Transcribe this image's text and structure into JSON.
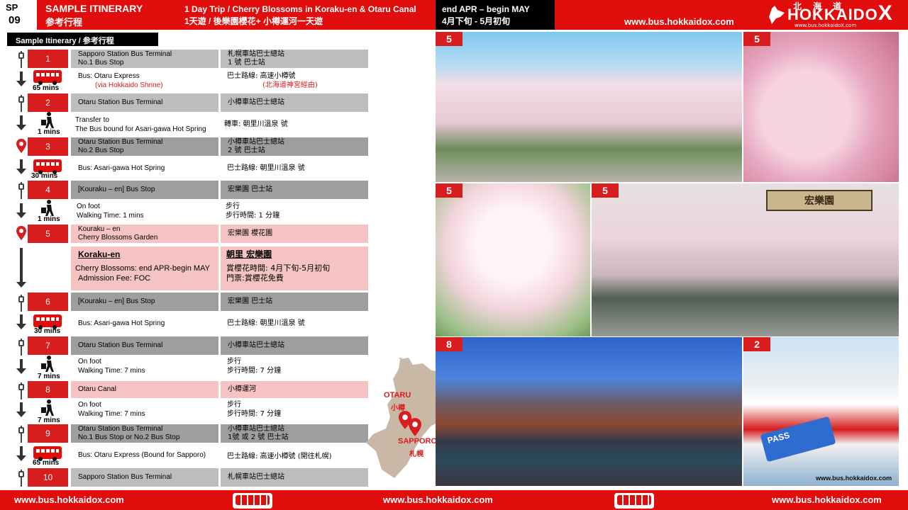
{
  "header": {
    "sp_label": "SP",
    "sp_number": "09",
    "title_en": "SAMPLE ITINERARY",
    "title_zh": "参考行程",
    "trip_en": "1 Day Trip / Cherry Blossoms in Koraku-en & Otaru Canal",
    "trip_zh": "1天遊 / 後樂園櫻花+ 小樽運河一天遊",
    "season_en": "end APR –  begin MAY",
    "season_zh": "4月下旬 - 5月初旬",
    "url": "www.bus.hokkaidox.com",
    "logo_text": "HOKKAIDO",
    "logo_x": "X",
    "logo_kanji": "北海道",
    "logo_sub": "www.bus.hokkaidoX.com"
  },
  "section_label": "Sample Itinerary / 参考行程",
  "stops": [
    {
      "num": "1",
      "en1": "Sapporo Station Bus Terminal",
      "en2": "No.1 Bus Stop",
      "zh1": "札幌車站巴士總站",
      "zh2": "1 號 巴士站"
    },
    {
      "num": "2",
      "en1": "Otaru Station Bus Terminal",
      "en2": "",
      "zh1": "小樽車站巴士總站",
      "zh2": ""
    },
    {
      "num": "3",
      "en1": "Otaru Station Bus Terminal",
      "en2": "No.2 Bus Stop",
      "zh1": "小樽車站巴士總站",
      "zh2": "2 號 巴士站"
    },
    {
      "num": "4",
      "en1": "[Kouraku – en] Bus Stop",
      "en2": "",
      "zh1": "宏樂園 巴士站",
      "zh2": ""
    },
    {
      "num": "5",
      "en1": "Kouraku – en",
      "en2": "Cherry Blossoms Garden",
      "zh1": "宏樂園  櫻花園",
      "zh2": ""
    },
    {
      "num": "6",
      "en1": "[Kouraku – en] Bus Stop",
      "en2": "",
      "zh1": "宏樂園 巴士站",
      "zh2": ""
    },
    {
      "num": "7",
      "en1": "Otaru Station Bus Terminal",
      "en2": "",
      "zh1": "小樽車站巴士總站",
      "zh2": ""
    },
    {
      "num": "8",
      "en1": "Otaru Canal",
      "en2": "",
      "zh1": "小樽運河",
      "zh2": ""
    },
    {
      "num": "9",
      "en1": "Otaru Station Bus Terminal",
      "en2": "No.1 Bus Stop or No.2 Bus Stop",
      "zh1": "小樽車站巴士總站",
      "zh2": "1號 或 2 號 巴士站"
    },
    {
      "num": "10",
      "en1": "Sapporo Station Bus Terminal",
      "en2": "",
      "zh1": "札幌車站巴士總站",
      "zh2": ""
    }
  ],
  "legs": [
    {
      "mins": "65 mins",
      "en1": "Bus: Otaru Express",
      "en2": "(via Hokkaido  Shrine)",
      "zh1": "巴士路線: 高速小樽號",
      "zh2": "(北海道神宮經由)"
    },
    {
      "mins": "1 mins",
      "en1": "Transfer to",
      "en2": "The Bus bound for Asari-gawa Hot Spring",
      "zh1": "轉車: 朝里川溫泉 號",
      "zh2": ""
    },
    {
      "mins": "30 mins",
      "en1": "Bus: Asari-gawa Hot Spring",
      "en2": "",
      "zh1": "巴士路線: 朝里川溫泉 號",
      "zh2": ""
    },
    {
      "mins": "1 mins",
      "en1": "On foot",
      "en2": "Walking Time:  1 mins",
      "zh1": "步行",
      "zh2": "步行時間: 1 分鐘"
    },
    {
      "mins": "30 mins",
      "en1": "Bus: Asari-gawa Hot Spring",
      "en2": "",
      "zh1": "巴士路線: 朝里川溫泉 號",
      "zh2": ""
    },
    {
      "mins": "7 mins",
      "en1": "On foot",
      "en2": "Walking Time:  7 mins",
      "zh1": "步行",
      "zh2": "步行時間: 7 分鐘"
    },
    {
      "mins": "7 mins",
      "en1": "On foot",
      "en2": "Walking Time:  7 mins",
      "zh1": "步行",
      "zh2": "步行時間: 7 分鐘"
    },
    {
      "mins": "65 mins",
      "en1": "Bus: Otaru Express (Bound for Sapporo)",
      "en2": "",
      "zh1": "巴士路線: 高速小樽號 (開往札幌)",
      "zh2": ""
    }
  ],
  "detail": {
    "en_title": "Koraku-en",
    "en_line1": "Cherry Blossoms: end APR-begin MAY",
    "en_line2": "Admission Fee: FOC",
    "zh_title": "朝里 宏樂園",
    "zh_line1": "賞櫻花時間: 4月下旬-5月初旬",
    "zh_line2": "門票:賞櫻花免費"
  },
  "photos": [
    {
      "tag": "5"
    },
    {
      "tag": "5"
    },
    {
      "tag": "5"
    },
    {
      "tag": "5"
    },
    {
      "tag": "8"
    },
    {
      "tag": "2"
    }
  ],
  "photo_text": {
    "garden_sign": "宏樂園",
    "ticket": "PASS",
    "bus_label": "www.bus.hokkaidox.com"
  },
  "map": {
    "otaru_en": "OTARU",
    "otaru_zh": "小樽",
    "sapporo_en": "SAPPORO",
    "sapporo_zh": "札幌"
  },
  "footer": {
    "url": "www.bus.hokkaidox.com"
  },
  "colors": {
    "brand_red": "#e10d0d",
    "stop_red": "#d71d1d",
    "row_gray": "#bdbdbd",
    "row_pink": "#f6c3c3"
  }
}
